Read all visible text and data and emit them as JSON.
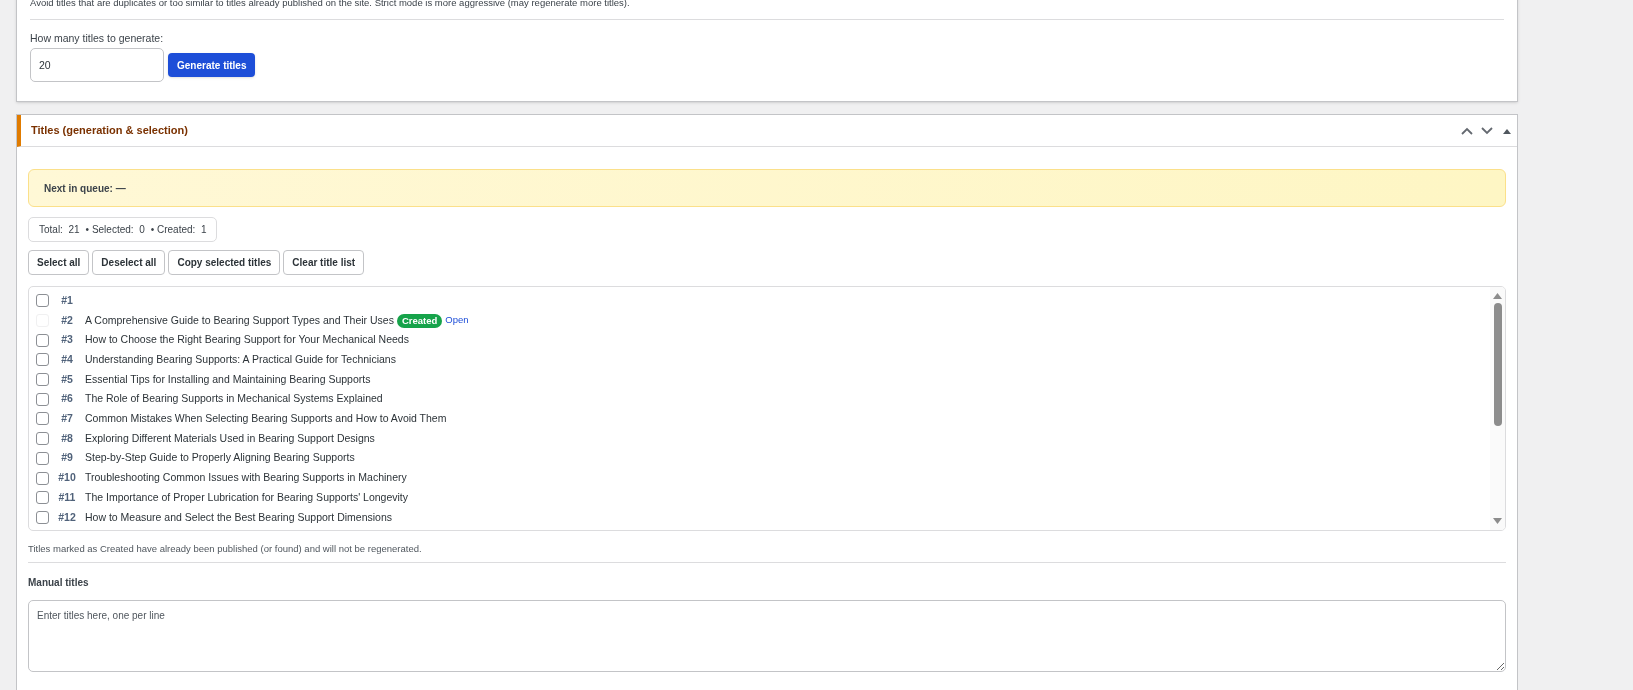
{
  "settings_card": {
    "hint": "Avoid titles that are duplicates or too similar to titles already published on the site. Strict mode is more aggressive (may regenerate more titles).",
    "count_label": "How many titles to generate:",
    "count_value": "20",
    "generate_button": "Generate titles"
  },
  "titles_panel": {
    "title": "Titles (generation & selection)",
    "next_in_queue": "Next in queue: —",
    "stats": [
      {
        "label": "Total:",
        "value": "21"
      },
      {
        "separator": "•",
        "label": "Selected:",
        "value": "0"
      },
      {
        "separator": "•",
        "label": "Created:",
        "value": "1"
      }
    ],
    "buttons": [
      "Select all",
      "Deselect all",
      "Copy selected titles",
      "Clear title list"
    ],
    "items": [
      {
        "number": "#1",
        "checked": false,
        "disabled": false
      },
      {
        "number": "#2",
        "title": "A Comprehensive Guide to Bearing Support Types and Their Uses",
        "checked": false,
        "disabled": true,
        "badge": "Created",
        "link": "Open"
      },
      {
        "number": "#3",
        "title": "How to Choose the Right Bearing Support for Your Mechanical Needs",
        "checked": false,
        "disabled": false
      },
      {
        "number": "#4",
        "title": "Understanding Bearing Supports: A Practical Guide for Technicians",
        "checked": false,
        "disabled": false
      },
      {
        "number": "#5",
        "title": "Essential Tips for Installing and Maintaining Bearing Supports",
        "checked": false,
        "disabled": false
      },
      {
        "number": "#6",
        "title": "The Role of Bearing Supports in Mechanical Systems Explained",
        "checked": false,
        "disabled": false
      },
      {
        "number": "#7",
        "title": "Common Mistakes When Selecting Bearing Supports and How to Avoid Them",
        "checked": false,
        "disabled": false
      },
      {
        "number": "#8",
        "title": "Exploring Different Materials Used in Bearing Support Designs",
        "checked": false,
        "disabled": false
      },
      {
        "number": "#9",
        "title": "Step-by-Step Guide to Properly Aligning Bearing Supports",
        "checked": false,
        "disabled": false
      },
      {
        "number": "#10",
        "title": "Troubleshooting Common Issues with Bearing Supports in Machinery",
        "checked": false,
        "disabled": false
      },
      {
        "number": "#11",
        "title": "The Importance of Proper Lubrication for Bearing Supports' Longevity",
        "checked": false,
        "disabled": false
      },
      {
        "number": "#12",
        "title": "How to Measure and Select the Best Bearing Support Dimensions",
        "checked": false,
        "disabled": false
      }
    ],
    "note": "Titles marked as Created have already been published (or found) and will not be regenerated.",
    "manual_label": "Manual titles",
    "manual_placeholder": "Enter titles here, one per line"
  }
}
